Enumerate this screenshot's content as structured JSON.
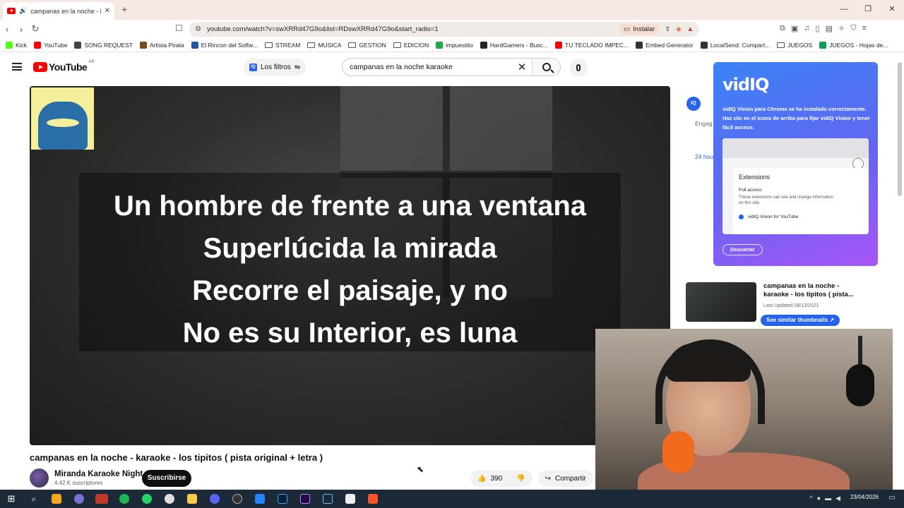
{
  "browser": {
    "tab_title": "campanas en la noche - karao",
    "url": "youtube.com/watch?v=swXRRd47G9o&list=RDswXRRd47G9o&start_radio=1",
    "install_label": "Instalar"
  },
  "bookmarks": [
    {
      "label": "Kick",
      "icon": "kick-icon",
      "color": "#53fc18"
    },
    {
      "label": "YouTube",
      "icon": "youtube-icon",
      "color": "#ff0000"
    },
    {
      "label": "SONG REQUEST",
      "icon": "globe-icon",
      "color": "#444444"
    },
    {
      "label": "Artista Pirata",
      "icon": "pirate-icon",
      "color": "#7a4a1a"
    },
    {
      "label": "El Rincon del Softw...",
      "icon": "e-icon",
      "color": "#2255aa"
    },
    {
      "label": "STREAM",
      "icon": "folder-icon",
      "color": ""
    },
    {
      "label": "MUSICA",
      "icon": "folder-icon",
      "color": ""
    },
    {
      "label": "GESTION",
      "icon": "folder-icon",
      "color": ""
    },
    {
      "label": "EDICION",
      "icon": "folder-icon",
      "color": ""
    },
    {
      "label": "impuestito",
      "icon": "leaf-icon",
      "color": "#22aa44"
    },
    {
      "label": "HardGamers - Busc...",
      "icon": "hg-icon",
      "color": "#222222"
    },
    {
      "label": "TU TECLADO IMPEC...",
      "icon": "youtube-icon",
      "color": "#ff0000"
    },
    {
      "label": "Embed Generator",
      "icon": "embed-icon",
      "color": "#333333"
    },
    {
      "label": "LocalSend: Compart...",
      "icon": "localsend-icon",
      "color": "#333333"
    },
    {
      "label": "JUEGOS",
      "icon": "folder-icon",
      "color": ""
    },
    {
      "label": "JUEGOS - Hojas de...",
      "icon": "sheets-icon",
      "color": "#0f9d58"
    }
  ],
  "youtube": {
    "logo_text": "YouTube",
    "country": "AR",
    "filters_label": "Los filtros",
    "search_value": "campanas en la noche karaoke"
  },
  "video": {
    "lyrics": [
      "Un hombre de frente a una ventana",
      "Superlúcida la mirada",
      "Recorre el paisaje, y no",
      "No es su Interior, es luna"
    ],
    "title": "campanas en la noche - karaoke - los tipitos ( pista original + letra )",
    "channel": "Miranda Karaoke Night",
    "subscribers": "4.42 K suscriptores",
    "subscribe_label": "Suscribirse",
    "likes": "390",
    "share_label": "Compartir"
  },
  "sidebar": {
    "engagement_label": "Engag",
    "period_label": "24 hou",
    "recommendation": {
      "title": "campanas en la noche - karaoke - los tipitos ( pista...",
      "meta": "Last Updated 08/13/2021",
      "button": "See similar thumbnails"
    }
  },
  "vidiq": {
    "logo": "vidIQ",
    "message": "vidIQ Vision para Chrome se ha instalado correctamente. Haz clic en el icono de arriba para fijar vidIQ Vision y tener fácil acceso.",
    "card_heading": "Extensions",
    "card_full_access": "Full access",
    "card_desc": "These extensions can see and change information on this site.",
    "card_item": "vidIQ Vision for YouTube",
    "dismiss_label": "Descartar"
  },
  "taskbar": {
    "date": "23/04/2026"
  }
}
